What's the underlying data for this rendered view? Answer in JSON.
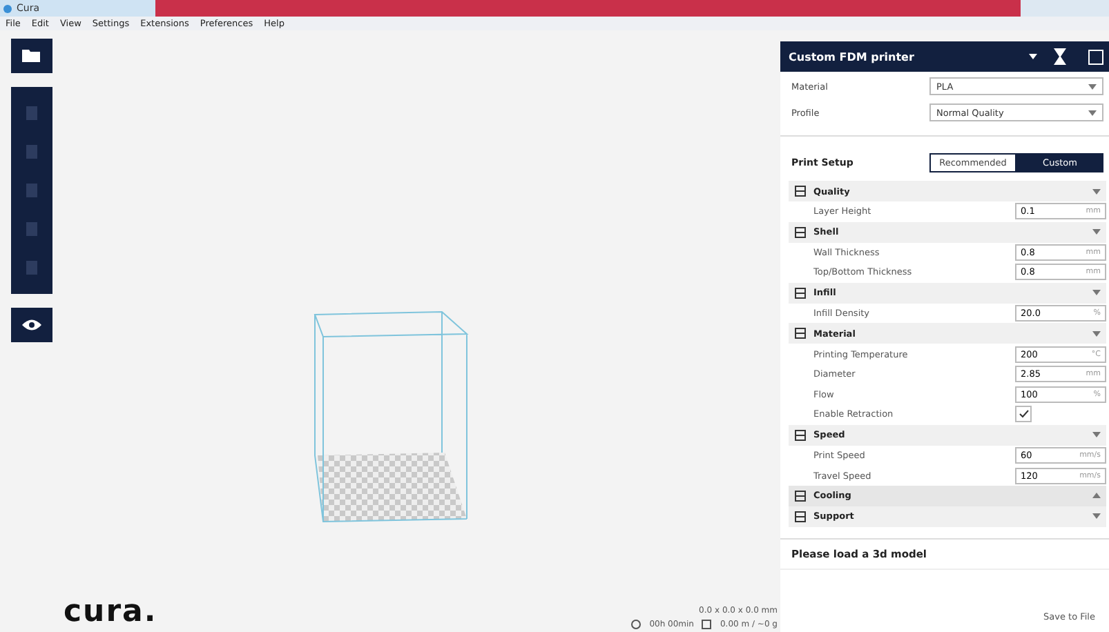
{
  "window": {
    "title": "Cura"
  },
  "menu": [
    "File",
    "Edit",
    "View",
    "Settings",
    "Extensions",
    "Preferences",
    "Help"
  ],
  "printer": {
    "name": "Custom FDM printer"
  },
  "material": {
    "label": "Material",
    "value": "PLA"
  },
  "profile": {
    "label": "Profile",
    "value": "Normal Quality"
  },
  "print_setup": {
    "label": "Print Setup",
    "tabs": [
      {
        "label": "Recommended",
        "selected": false
      },
      {
        "label": "Custom",
        "selected": true
      }
    ]
  },
  "settings": [
    {
      "kind": "category",
      "label": "Quality",
      "expanded": true
    },
    {
      "kind": "value",
      "label": "Layer Height",
      "value": "0.1",
      "unit": "mm"
    },
    {
      "kind": "category",
      "label": "Shell",
      "expanded": true
    },
    {
      "kind": "value",
      "label": "Wall Thickness",
      "value": "0.8",
      "unit": "mm"
    },
    {
      "kind": "value",
      "label": "Top/Bottom Thickness",
      "value": "0.8",
      "unit": "mm"
    },
    {
      "kind": "category",
      "label": "Infill",
      "expanded": true
    },
    {
      "kind": "value",
      "label": "Infill Density",
      "value": "20.0",
      "unit": "%"
    },
    {
      "kind": "category",
      "label": "Material",
      "expanded": true
    },
    {
      "kind": "value",
      "label": "Printing Temperature",
      "value": "200",
      "unit": "°C"
    },
    {
      "kind": "value",
      "label": "Diameter",
      "value": "2.85",
      "unit": "mm"
    },
    {
      "kind": "value",
      "label": "Flow",
      "value": "100",
      "unit": "%"
    },
    {
      "kind": "checkbox",
      "label": "Enable Retraction",
      "checked": true
    },
    {
      "kind": "category",
      "label": "Speed",
      "expanded": true
    },
    {
      "kind": "value",
      "label": "Print Speed",
      "value": "60",
      "unit": "mm/s"
    },
    {
      "kind": "value",
      "label": "Travel Speed",
      "value": "120",
      "unit": "mm/s"
    },
    {
      "kind": "category",
      "label": "Cooling",
      "expanded": false
    },
    {
      "kind": "category",
      "label": "Support",
      "expanded": true
    }
  ],
  "message": "Please load a 3d model",
  "save_button": "Save to File",
  "viewport": {
    "logo": "cura.",
    "dimensions": "0.0 x 0.0 x 0.0 mm",
    "time": "00h 00min",
    "filament": "0.00 m / ~0 g"
  }
}
